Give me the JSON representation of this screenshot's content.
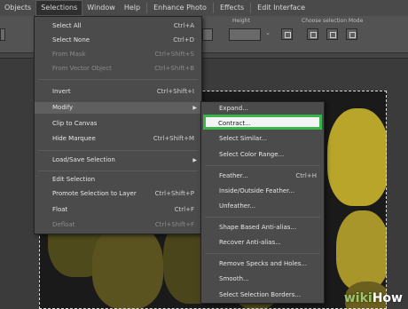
{
  "menubar": {
    "items": [
      "Objects",
      "Selections",
      "Window",
      "Help",
      "Enhance Photo",
      "Effects",
      "Edit Interface"
    ],
    "active": "Selections"
  },
  "toolbar": {
    "height_label": "Height",
    "mode_label": "Choose selection Mode"
  },
  "selections_menu": {
    "items": [
      {
        "label": "Select All",
        "shortcut": "Ctrl+A",
        "disabled": false
      },
      {
        "label": "Select None",
        "shortcut": "Ctrl+D",
        "disabled": false
      },
      {
        "label": "From Mask",
        "shortcut": "Ctrl+Shift+S",
        "disabled": true
      },
      {
        "label": "From Vector Object",
        "shortcut": "Ctrl+Shift+B",
        "disabled": true
      },
      {
        "label": "Invert",
        "shortcut": "Ctrl+Shift+I",
        "disabled": false
      },
      {
        "label": "Modify",
        "shortcut": "",
        "disabled": false,
        "submenu": true
      },
      {
        "label": "Clip to Canvas",
        "shortcut": "",
        "disabled": false
      },
      {
        "label": "Hide Marquee",
        "shortcut": "Ctrl+Shift+M",
        "disabled": false
      },
      {
        "label": "Load/Save Selection",
        "shortcut": "",
        "disabled": false,
        "submenu": true
      },
      {
        "label": "Edit Selection",
        "shortcut": "",
        "disabled": false
      },
      {
        "label": "Promote Selection to Layer",
        "shortcut": "Ctrl+Shift+P",
        "disabled": false
      },
      {
        "label": "Float",
        "shortcut": "Ctrl+F",
        "disabled": false
      },
      {
        "label": "Defloat",
        "shortcut": "Ctrl+Shift+F",
        "disabled": true
      }
    ]
  },
  "modify_submenu": {
    "items": [
      {
        "label": "Expand...",
        "shortcut": ""
      },
      {
        "label": "Contract...",
        "shortcut": "",
        "selected": true
      },
      {
        "label": "Select Similar...",
        "shortcut": ""
      },
      {
        "label": "Select Color Range...",
        "shortcut": ""
      },
      {
        "label": "Feather...",
        "shortcut": "Ctrl+H"
      },
      {
        "label": "Inside/Outside Feather...",
        "shortcut": ""
      },
      {
        "label": "Unfeather...",
        "shortcut": ""
      },
      {
        "label": "Shape Based Anti-alias...",
        "shortcut": ""
      },
      {
        "label": "Recover Anti-alias...",
        "shortcut": ""
      },
      {
        "label": "Remove Specks and Holes...",
        "shortcut": ""
      },
      {
        "label": "Smooth...",
        "shortcut": ""
      },
      {
        "label": "Select Selection Borders...",
        "shortcut": ""
      }
    ]
  },
  "watermark": {
    "part1": "wiki",
    "part2": "How"
  },
  "colors": {
    "highlight_border": "#39b54a"
  }
}
